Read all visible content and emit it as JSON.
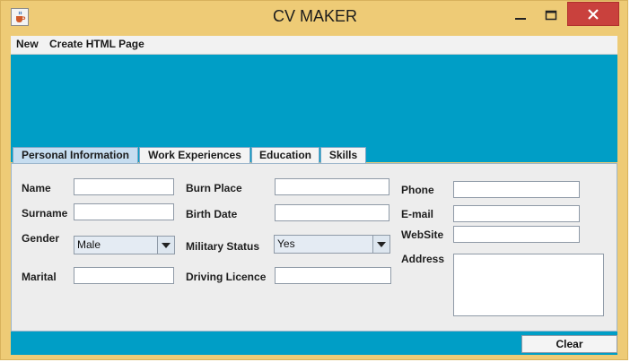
{
  "window": {
    "title": "CV MAKER",
    "icons": {
      "app": "java-cup-icon",
      "minimize": "minimize-icon",
      "maximize": "maximize-icon",
      "close": "close-icon"
    }
  },
  "menu": {
    "items": [
      "New",
      "Create HTML Page"
    ]
  },
  "tabs": [
    "Personal Information",
    "Work Experiences",
    "Education",
    "Skills"
  ],
  "form": {
    "col1": {
      "name_label": "Name",
      "surname_label": "Surname",
      "gender_label": "Gender",
      "gender_value": "Male",
      "marital_label": "Marital"
    },
    "col2": {
      "burn_place_label": "Burn Place",
      "birth_date_label": "Birth Date",
      "military_label": "Military Status",
      "military_value": "Yes",
      "driving_label": "Driving Licence"
    },
    "col3": {
      "phone_label": "Phone",
      "email_label": "E-mail",
      "website_label": "WebSite",
      "address_label": "Address"
    }
  },
  "footer": {
    "clear_label": "Clear"
  },
  "colors": {
    "banner": "#009ec6",
    "frame": "#eecb76",
    "close": "#c9413d",
    "active_tab": "#c6ddf0"
  }
}
